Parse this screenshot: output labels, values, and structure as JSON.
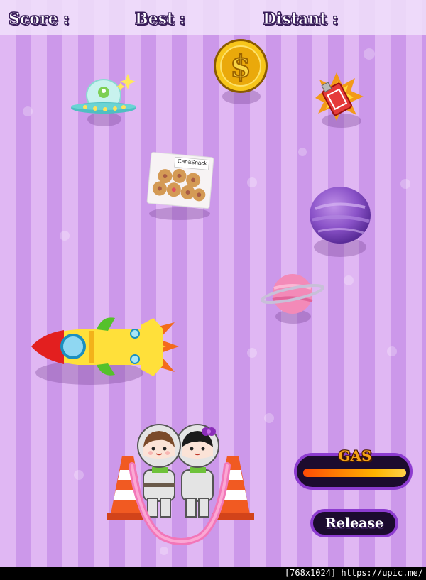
{
  "hud": {
    "score_label": "Score :",
    "best_label": "Best :",
    "distance_label": "Distant :"
  },
  "items": {
    "snack_label": "CanaSnack"
  },
  "gas": {
    "label": "GAS",
    "level": 1.0
  },
  "controls": {
    "release_label": "Release"
  },
  "watermark": "[768x1024] https://upic.me/",
  "colors": {
    "stripe_light": "#e0b7f3",
    "stripe_dark": "#cc98ea",
    "panel_border": "#8d3cd0",
    "gas_text": "#f5a417"
  }
}
